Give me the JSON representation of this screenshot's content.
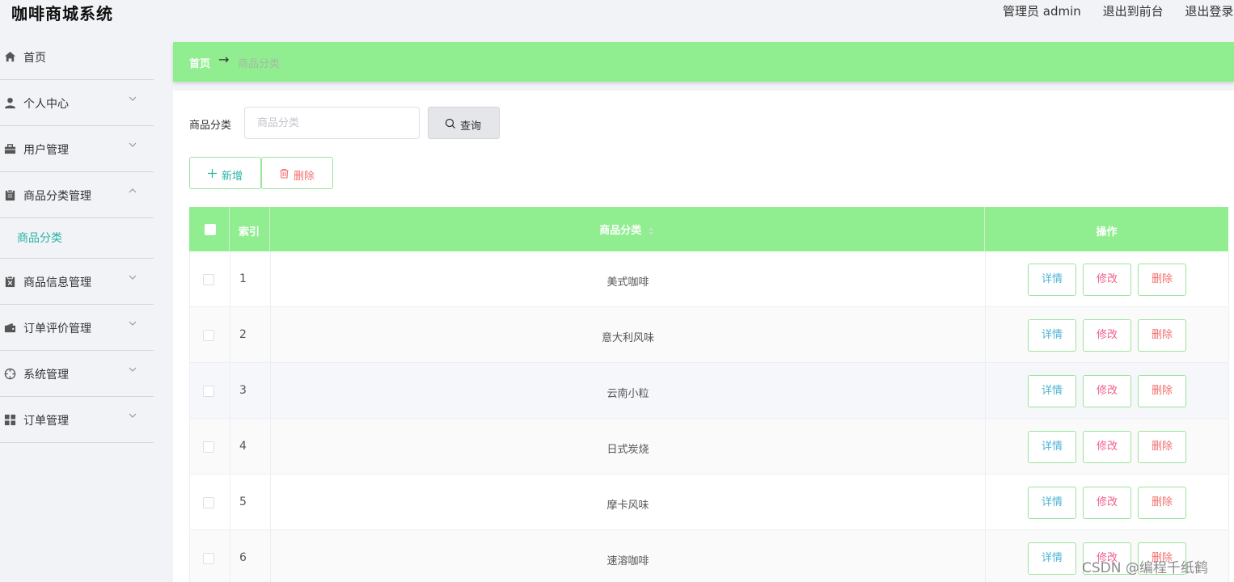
{
  "header": {
    "app_title": "咖啡商城系统",
    "user_label": "管理员 admin",
    "to_front": "退出到前台",
    "logout": "退出登录"
  },
  "sidebar": {
    "items": [
      {
        "label": "首页",
        "icon": "home-icon"
      },
      {
        "label": "个人中心",
        "icon": "user-icon"
      },
      {
        "label": "用户管理",
        "icon": "briefcase-icon"
      },
      {
        "label": "商品分类管理",
        "icon": "clipboard-icon",
        "expanded": true
      },
      {
        "label": "商品信息管理",
        "icon": "clipboard-x-icon"
      },
      {
        "label": "订单评价管理",
        "icon": "wallet-icon"
      },
      {
        "label": "系统管理",
        "icon": "crosshair-icon"
      },
      {
        "label": "订单管理",
        "icon": "grid-icon"
      }
    ],
    "sub_active": "商品分类"
  },
  "breadcrumb": {
    "home": "首页",
    "arrow": "→",
    "current": "商品分类"
  },
  "search": {
    "label": "商品分类",
    "placeholder": "商品分类",
    "button": "查询"
  },
  "actions": {
    "add": "新增",
    "delete": "删除"
  },
  "table": {
    "columns": {
      "index": "索引",
      "category": "商品分类",
      "ops": "操作"
    },
    "rows": [
      {
        "index": "1",
        "category": "美式咖啡"
      },
      {
        "index": "2",
        "category": "意大利风味"
      },
      {
        "index": "3",
        "category": "云南小粒"
      },
      {
        "index": "4",
        "category": "日式炭烧"
      },
      {
        "index": "5",
        "category": "摩卡风味"
      },
      {
        "index": "6",
        "category": "速溶咖啡"
      }
    ],
    "op_labels": {
      "detail": "详情",
      "edit": "修改",
      "delete": "删除"
    }
  },
  "watermark": "CSDN @编程千纸鹤",
  "colors": {
    "accent_green": "#90ee90",
    "teal": "#27b3a7",
    "danger": "#f56c6c"
  }
}
